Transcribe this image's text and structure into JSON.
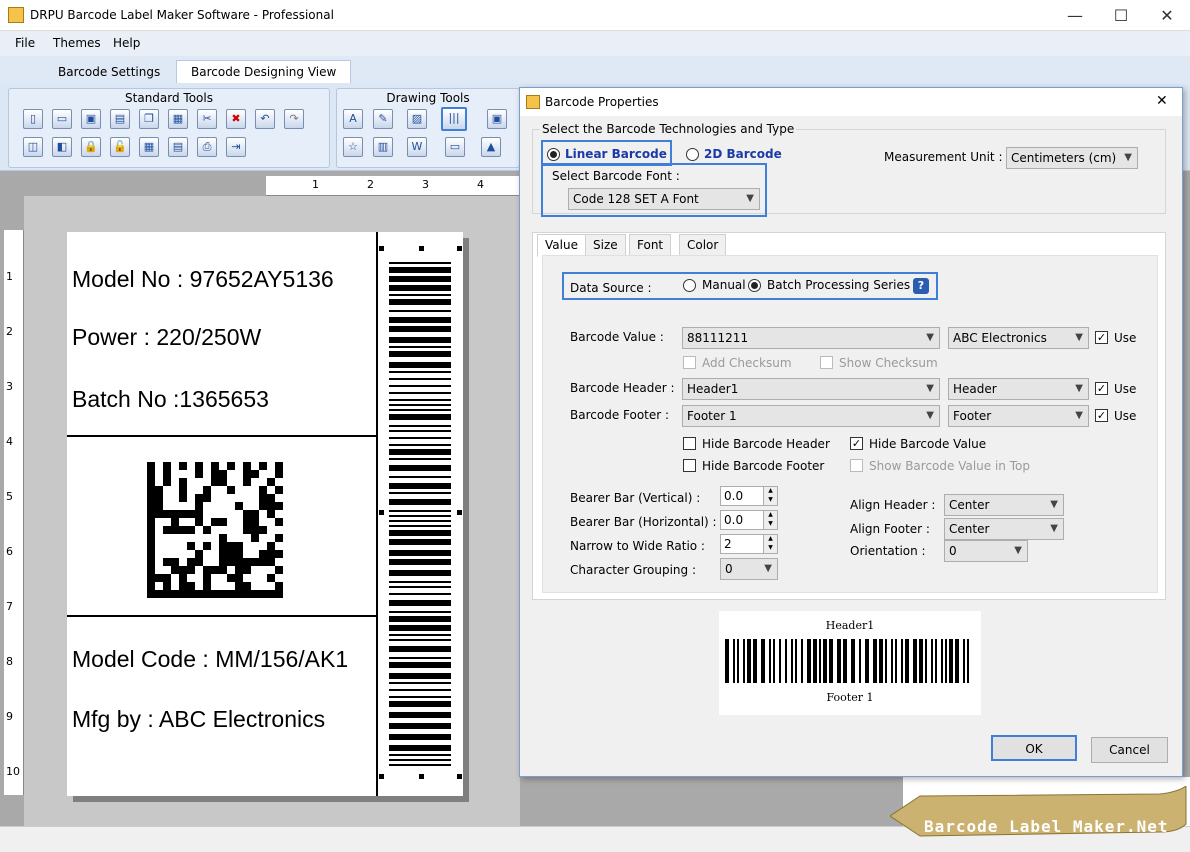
{
  "window": {
    "title": "DRPU Barcode Label Maker Software - Professional",
    "minimize": "—",
    "maximize": "☐",
    "close": "✕"
  },
  "menu": [
    "File",
    "Themes",
    "Help"
  ],
  "tabs": [
    "Barcode Settings",
    "Barcode Designing View"
  ],
  "ribbon": {
    "standard_tools": "Standard Tools",
    "drawing_tools": "Drawing Tools"
  },
  "ruler": {
    "h": [
      "1",
      "2",
      "3",
      "4"
    ],
    "v": [
      "1",
      "2",
      "3",
      "4",
      "5",
      "6",
      "7",
      "8",
      "9",
      "10"
    ]
  },
  "label": {
    "lines": [
      "Model No : 97652AY5136",
      "Power : 220/250W",
      "Batch No :1365653",
      "Model Code : MM/156/AK1",
      "Mfg by : ABC Electronics"
    ]
  },
  "dialog": {
    "title": "Barcode Properties",
    "close": "✕",
    "tech_legend": "Select the Barcode Technologies and Type",
    "linear": "Linear Barcode",
    "twod": "2D Barcode",
    "font_label": "Select Barcode Font :",
    "font_value": "Code 128 SET A Font",
    "unit_label": "Measurement Unit :",
    "unit_value": "Centimeters (cm)",
    "tabs": [
      "Value",
      "Size",
      "Font",
      "Color"
    ],
    "data_source_label": "Data Source :",
    "manual": "Manual",
    "batch": "Batch Processing Series",
    "help": "?",
    "value_label": "Barcode Value :",
    "value_value": "88111211",
    "value_field": "ABC Electronics",
    "use": "Use",
    "add_checksum": "Add Checksum",
    "show_checksum": "Show Checksum",
    "header_label": "Barcode Header :",
    "header_value": "Header1",
    "header_field": "Header",
    "footer_label": "Barcode Footer :",
    "footer_value": "Footer 1",
    "footer_field": "Footer",
    "hide_header": "Hide Barcode Header",
    "hide_value": "Hide Barcode Value",
    "hide_footer": "Hide Barcode Footer",
    "show_top": "Show Barcode Value in Top",
    "bearer_v_label": "Bearer Bar (Vertical) :",
    "bearer_v": "0.0",
    "bearer_h_label": "Bearer Bar (Horizontal) :",
    "bearer_h": "0.0",
    "narrow_label": "Narrow to Wide Ratio :",
    "narrow": "2",
    "grouping_label": "Character Grouping :",
    "grouping": "0",
    "align_header_label": "Align Header :",
    "align_header": "Center",
    "align_footer_label": "Align Footer :",
    "align_footer": "Center",
    "orientation_label": "Orientation :",
    "orientation": "0",
    "preview_header": "Header1",
    "preview_footer": "Footer 1",
    "ok": "OK",
    "cancel": "Cancel"
  },
  "banner": "Barcode Label Maker.Net"
}
